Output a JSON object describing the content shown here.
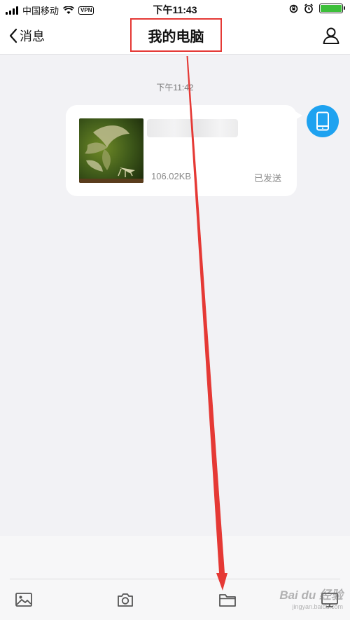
{
  "status_bar": {
    "carrier": "中国移动",
    "vpn": "VPN",
    "time": "下午11:43",
    "battery_level": 1.0
  },
  "nav": {
    "back_label": "消息",
    "title": "我的电脑",
    "profile_icon": "person-icon"
  },
  "chat": {
    "timestamp": "下午11:42",
    "message": {
      "file_name": "",
      "file_size": "106.02KB",
      "status": "已发送"
    },
    "avatar_icon": "phone-icon",
    "avatar_color": "#1ea2f0"
  },
  "toolbar": {
    "items": [
      "image-icon",
      "camera-icon",
      "folder-icon",
      "computer-icon"
    ]
  },
  "watermark": {
    "brand": "Bai du 经验",
    "url": "jingyan.baidu.com"
  },
  "colors": {
    "annotation": "#e53935",
    "accent": "#1ea2f0",
    "background": "#f2f2f5"
  }
}
